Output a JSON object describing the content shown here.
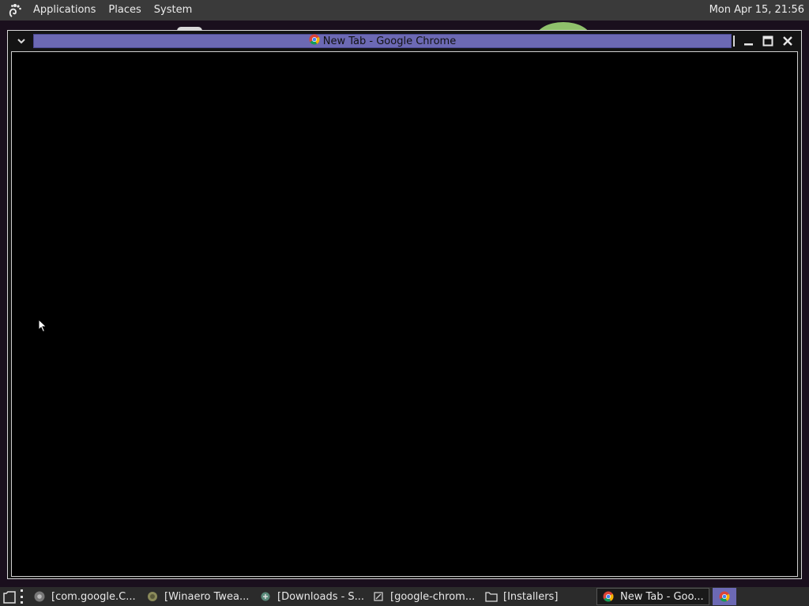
{
  "top_panel": {
    "menus": [
      "Applications",
      "Places",
      "System"
    ],
    "clock": "Mon Apr 15, 21:56"
  },
  "window": {
    "title": "New Tab - Google Chrome",
    "title_icon": "chrome-icon",
    "buttons": [
      "window-menu",
      "minimize",
      "maximize",
      "close"
    ]
  },
  "taskbar": {
    "tasks": [
      {
        "label": "[com.google.C...",
        "icon": "chrome-icon"
      },
      {
        "label": "[Winaero Twea...",
        "icon": "winaero-icon"
      },
      {
        "label": "[Downloads - S...",
        "icon": "app-icon"
      },
      {
        "label": "[google-chrom...",
        "icon": "script-icon"
      },
      {
        "label": "[Installers]",
        "icon": "folder-icon"
      },
      {
        "label": "New Tab - Goo...",
        "icon": "chrome-icon",
        "active": true
      }
    ],
    "tray_icon": "chrome-icon"
  },
  "colors": {
    "title_active": "#6c69b4",
    "panel": "#3a3a3a",
    "taskbar": "#2b2b2b"
  }
}
